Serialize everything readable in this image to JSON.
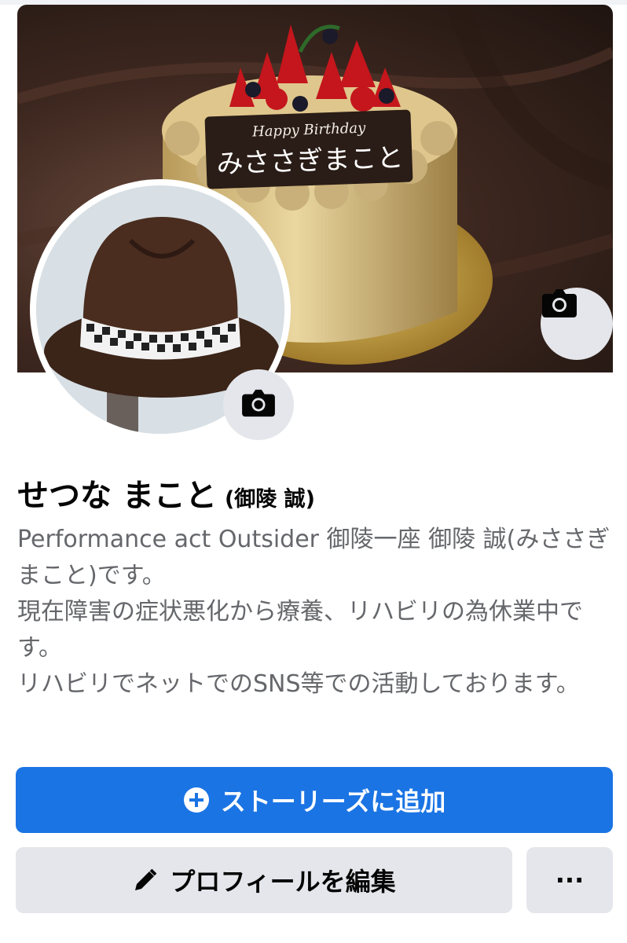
{
  "profile": {
    "name": "せつな まこと",
    "alt_name": "(御陵 誠)",
    "bio": "Performance act Outsider 御陵一座 御陵 誠(みささぎ まこと)です。\n現在障害の症状悪化から療養、リハビリの為休業中です。\nリハビリでネットでのSNS等での活動しております。"
  },
  "cover": {
    "plaque_top": "Happy Birthday",
    "plaque_main": "みささぎまこと"
  },
  "actions": {
    "add_story_label": "ストーリーズに追加",
    "edit_profile_label": "プロフィールを編集",
    "more_label": "···"
  },
  "icons": {
    "cover_camera": "camera-icon",
    "avatar_camera": "camera-icon",
    "add": "plus-circle-icon",
    "edit": "pencil-icon"
  },
  "colors": {
    "primary": "#1b74e4",
    "secondary_bg": "#e4e6eb",
    "text": "#050505",
    "muted_text": "#65676b"
  }
}
